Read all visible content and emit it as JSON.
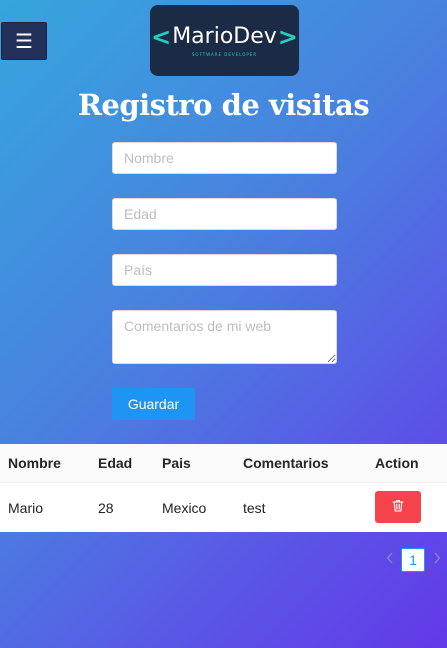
{
  "header": {
    "menu_icon": "hamburger-icon",
    "logo": {
      "bracket_left": "<",
      "text": "MarioDev",
      "bracket_right": ">",
      "tagline": "SOFTWARE DEVELOPER"
    }
  },
  "title": "Registro de visitas",
  "form": {
    "nombre_placeholder": "Nombre",
    "edad_placeholder": "Edad",
    "pais_placeholder": "País",
    "comentarios_placeholder": "Comentarios de mi web",
    "save_label": "Guardar"
  },
  "table": {
    "columns": [
      "Nombre",
      "Edad",
      "Pais",
      "Comentarios",
      "Action"
    ],
    "rows": [
      {
        "nombre": "Mario",
        "edad": "28",
        "pais": "Mexico",
        "comentarios": "test",
        "action_icon": "trash-icon"
      }
    ]
  },
  "pagination": {
    "current_page": "1",
    "prev_icon": "chevron-left-icon",
    "next_icon": "chevron-right-icon"
  },
  "colors": {
    "primary": "#1e95f5",
    "danger": "#f5444c",
    "logo_bg": "#1c2b45",
    "logo_accent": "#1fd1c1",
    "menu_bg": "#23305a"
  }
}
